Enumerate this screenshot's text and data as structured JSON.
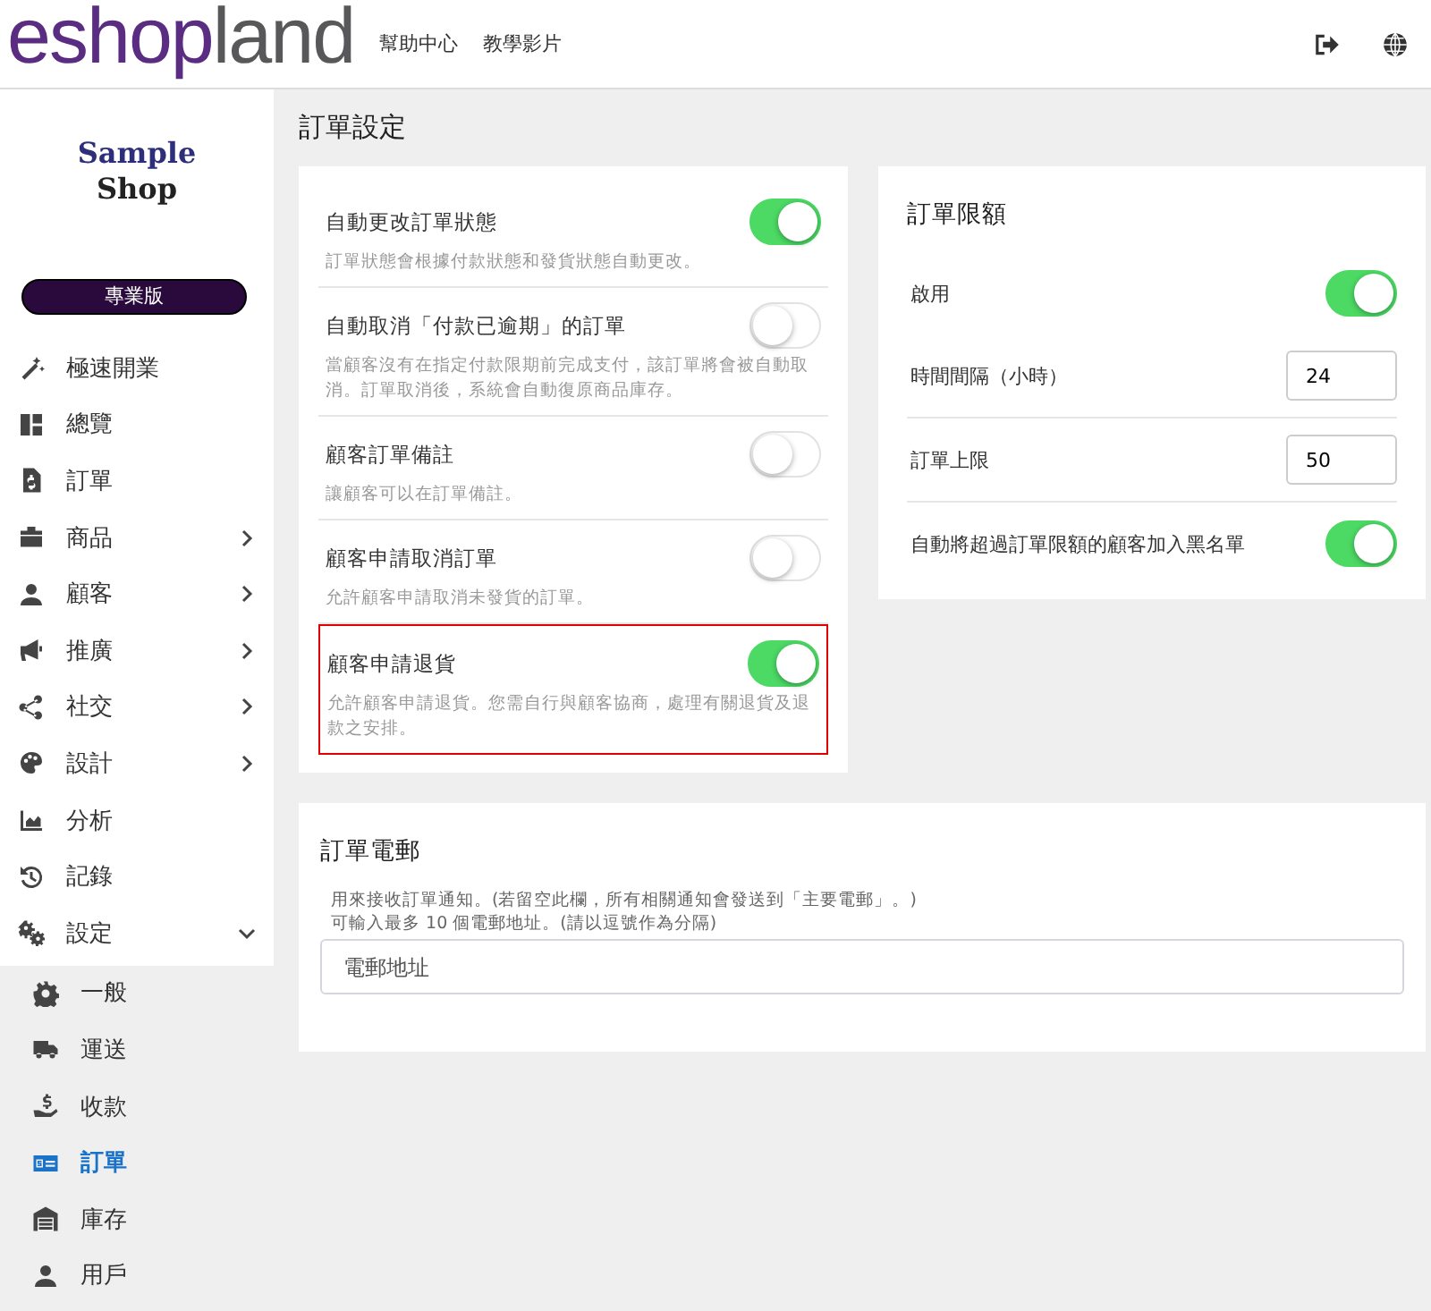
{
  "header": {
    "logo_parts": [
      {
        "text": "eshop",
        "color": "#5a2d82"
      },
      {
        "text": "land",
        "color": "#58585a"
      }
    ],
    "nav": [
      "幫助中心",
      "教學影片"
    ]
  },
  "sidebar": {
    "shop_logo": [
      "Sample",
      "Shop"
    ],
    "plan_badge": "專業版",
    "items": [
      {
        "label": "極速開業",
        "kind": "link"
      },
      {
        "label": "總覽",
        "kind": "link"
      },
      {
        "label": "訂單",
        "kind": "link"
      },
      {
        "label": "商品",
        "kind": "group",
        "expanded": false
      },
      {
        "label": "顧客",
        "kind": "group",
        "expanded": false
      },
      {
        "label": "推廣",
        "kind": "group",
        "expanded": false
      },
      {
        "label": "社交",
        "kind": "group",
        "expanded": false
      },
      {
        "label": "設計",
        "kind": "group",
        "expanded": false
      },
      {
        "label": "分析",
        "kind": "link"
      },
      {
        "label": "記錄",
        "kind": "link"
      },
      {
        "label": "設定",
        "kind": "group",
        "expanded": true,
        "children": [
          {
            "label": "一般",
            "selected": false
          },
          {
            "label": "運送",
            "selected": false
          },
          {
            "label": "收款",
            "selected": false
          },
          {
            "label": "訂單",
            "selected": true
          },
          {
            "label": "庫存",
            "selected": false
          },
          {
            "label": "用戶",
            "selected": false
          }
        ]
      }
    ]
  },
  "page_title": "訂單設定",
  "order_settings": [
    {
      "title": "自動更改訂單狀態",
      "description": "訂單狀態會根據付款狀態和發貨狀態自動更改。",
      "on": true,
      "highlighted": false
    },
    {
      "title": "自動取消「付款已逾期」的訂單",
      "description": "當顧客沒有在指定付款限期前完成支付，該訂單將會被自動取消。訂單取消後，系統會自動復原商品庫存。",
      "on": false,
      "highlighted": false
    },
    {
      "title": "顧客訂單備註",
      "description": "讓顧客可以在訂單備註。",
      "on": false,
      "highlighted": false
    },
    {
      "title": "顧客申請取消訂單",
      "description": "允許顧客申請取消未發貨的訂單。",
      "on": false,
      "highlighted": false
    },
    {
      "title": "顧客申請退貨",
      "description": "允許顧客申請退貨。您需自行與顧客協商，處理有關退貨及退款之安排。",
      "on": true,
      "highlighted": true
    }
  ],
  "order_limit": {
    "title": "訂單限額",
    "rows": [
      {
        "kind": "toggle",
        "label": "啟用",
        "on": true
      },
      {
        "kind": "input",
        "label": "時間間隔（小時）",
        "value": "24"
      },
      {
        "kind": "input",
        "label": "訂單上限",
        "value": "50"
      },
      {
        "kind": "toggle",
        "label": "自動將超過訂單限額的顧客加入黑名單",
        "on": true
      }
    ]
  },
  "order_email": {
    "title": "訂單電郵",
    "help": [
      "用來接收訂單通知。(若留空此欄，所有相關通知會發送到「主要電郵」。)",
      "可輸入最多 10 個電郵地址。(請以逗號作為分隔)"
    ],
    "placeholder": "電郵地址"
  }
}
